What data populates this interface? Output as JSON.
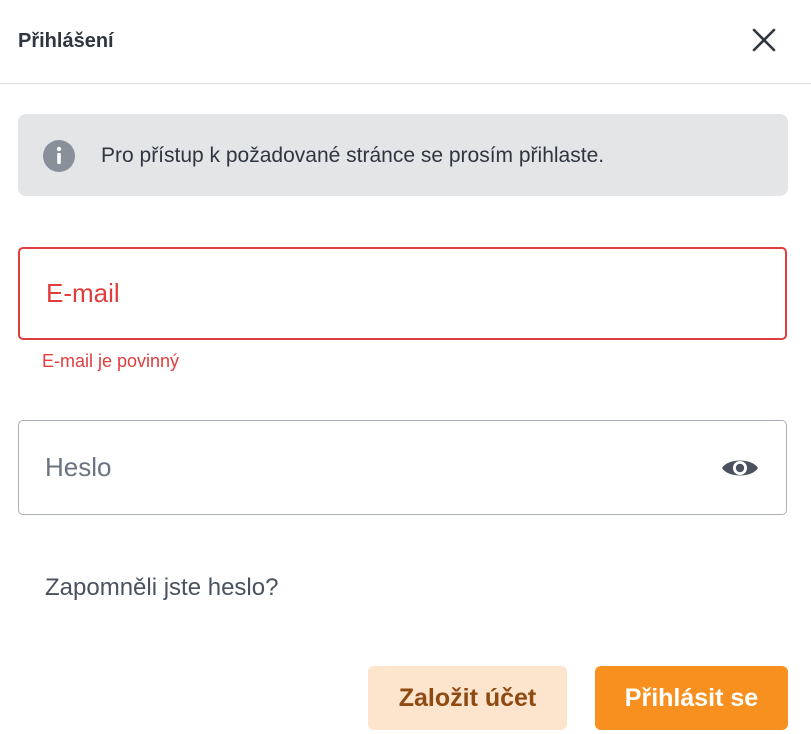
{
  "dialog": {
    "title": "Přihlášení",
    "close_icon": "close-icon"
  },
  "info": {
    "icon": "info-icon",
    "text": "Pro přístup k požadované stránce se prosím přihlaste."
  },
  "form": {
    "email": {
      "placeholder": "E-mail",
      "value": "",
      "error": "E-mail je povinný"
    },
    "password": {
      "placeholder": "Heslo",
      "value": "",
      "toggle_icon": "eye-icon"
    },
    "forgot_link": "Zapomněli jste heslo?"
  },
  "actions": {
    "register_label": "Založit účet",
    "login_label": "Přihlásit se"
  },
  "colors": {
    "accent": "#f7901e",
    "accent_light": "#fde4cd",
    "error": "#e03d3d",
    "info_bg": "#e4e5e7"
  }
}
